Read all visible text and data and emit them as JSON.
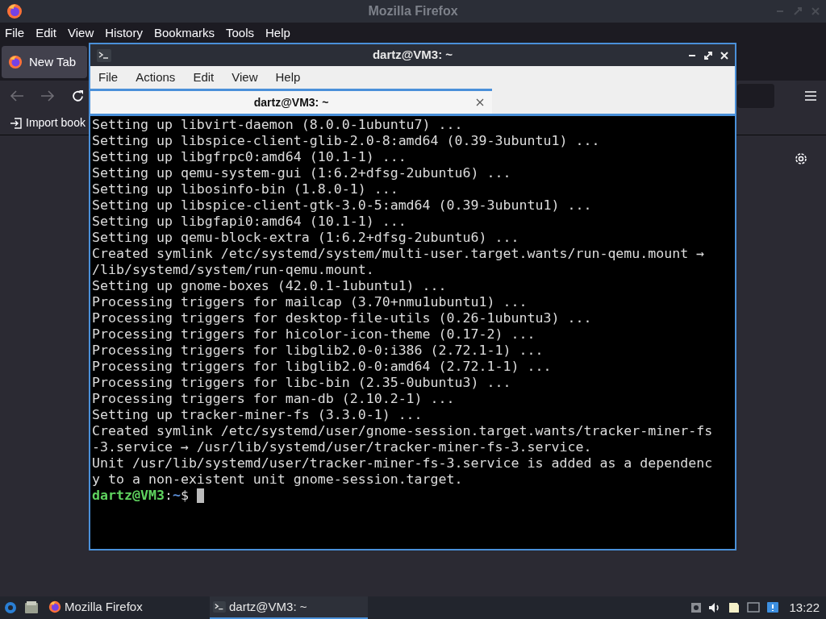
{
  "firefox": {
    "title": "Mozilla Firefox",
    "menu": [
      "File",
      "Edit",
      "View",
      "History",
      "Bookmarks",
      "Tools",
      "Help"
    ],
    "tabs": [
      {
        "label": "New Tab",
        "selected": true
      }
    ],
    "bookmarks_bar": {
      "import_label": "Import book"
    }
  },
  "terminal": {
    "title": "dartz@VM3: ~",
    "menu": [
      "File",
      "Actions",
      "Edit",
      "View",
      "Help"
    ],
    "tabs": [
      {
        "label": "dartz@VM3: ~",
        "selected": true
      }
    ],
    "lines": [
      "Setting up libvirt-daemon (8.0.0-1ubuntu7) ...",
      "Setting up libspice-client-glib-2.0-8:amd64 (0.39-3ubuntu1) ...",
      "Setting up libgfrpc0:amd64 (10.1-1) ...",
      "Setting up qemu-system-gui (1:6.2+dfsg-2ubuntu6) ...",
      "Setting up libosinfo-bin (1.8.0-1) ...",
      "Setting up libspice-client-gtk-3.0-5:amd64 (0.39-3ubuntu1) ...",
      "Setting up libgfapi0:amd64 (10.1-1) ...",
      "Setting up qemu-block-extra (1:6.2+dfsg-2ubuntu6) ...",
      "Created symlink /etc/systemd/system/multi-user.target.wants/run-qemu.mount →",
      "/lib/systemd/system/run-qemu.mount.",
      "Setting up gnome-boxes (42.0.1-1ubuntu1) ...",
      "Processing triggers for mailcap (3.70+nmu1ubuntu1) ...",
      "Processing triggers for desktop-file-utils (0.26-1ubuntu3) ...",
      "Processing triggers for hicolor-icon-theme (0.17-2) ...",
      "Processing triggers for libglib2.0-0:i386 (2.72.1-1) ...",
      "Processing triggers for libglib2.0-0:amd64 (2.72.1-1) ...",
      "Processing triggers for libc-bin (2.35-0ubuntu3) ...",
      "Processing triggers for man-db (2.10.2-1) ...",
      "Setting up tracker-miner-fs (3.3.0-1) ...",
      "Created symlink /etc/systemd/user/gnome-session.target.wants/tracker-miner-fs",
      "-3.service → /usr/lib/systemd/user/tracker-miner-fs-3.service.",
      "Unit /usr/lib/systemd/user/tracker-miner-fs-3.service is added as a dependenc",
      "y to a non-existent unit gnome-session.target."
    ],
    "prompt": {
      "user_host": "dartz@VM3",
      "separator": ":",
      "path": "~",
      "symbol": "$"
    }
  },
  "taskbar": {
    "tasks": [
      {
        "label": "Mozilla Firefox",
        "kind": "firefox",
        "selected": false
      },
      {
        "label": "dartz@VM3: ~",
        "kind": "terminal",
        "selected": true
      }
    ],
    "clock": "13:22"
  }
}
